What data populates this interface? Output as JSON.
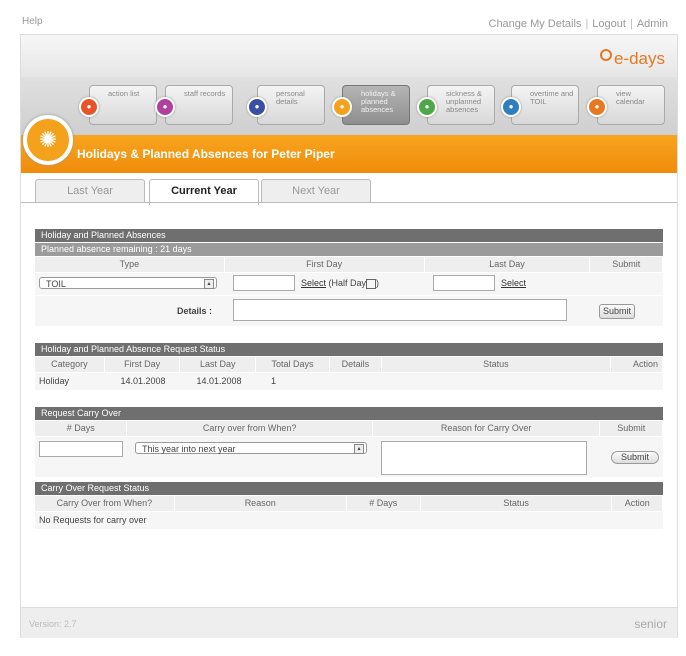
{
  "top": {
    "help": "Help",
    "change_details": "Change My Details",
    "logout": "Logout",
    "admin": "Admin",
    "sep": "|"
  },
  "logo": "e-days",
  "nav": [
    {
      "label": "action list",
      "color": "#e8542a"
    },
    {
      "label": "staff records",
      "color": "#b03fa0"
    },
    {
      "label": "personal details",
      "color": "#3a4fa3"
    },
    {
      "label": "holidays & planned absences",
      "color": "#f4a11c"
    },
    {
      "label": "sickness & unplanned absences",
      "color": "#4ea84a"
    },
    {
      "label": "overtime and TOIL",
      "color": "#2f7ec2"
    },
    {
      "label": "view calendar",
      "color": "#e87722"
    }
  ],
  "banner_title": "Holidays & Planned Absences for Peter Piper",
  "tabs": [
    "Last Year",
    "Current Year",
    "Next Year"
  ],
  "holiday": {
    "heading": "Holiday and Planned Absences",
    "remaining": "Planned absence remaining : 21 days",
    "cols": {
      "type": "Type",
      "first": "First Day",
      "last": "Last Day",
      "submit": "Submit"
    },
    "type_value": "TOIL",
    "select_label": "Select",
    "half_day": "(Half Day",
    "half_day_close": ")",
    "details_label": "Details :",
    "submit_label": "Submit"
  },
  "status": {
    "heading": "Holiday and Planned Absence Request Status",
    "cols": [
      "Category",
      "First Day",
      "Last Day",
      "Total Days",
      "Details",
      "Status",
      "Action"
    ],
    "rows": [
      {
        "category": "Holiday",
        "first": "14.01.2008",
        "last": "14.01.2008",
        "total": "1"
      }
    ]
  },
  "carry": {
    "heading": "Request Carry Over",
    "cols": {
      "days": "# Days",
      "from": "Carry over from When?",
      "reason": "Reason for Carry Over",
      "submit": "Submit"
    },
    "from_value": "This year into next year",
    "submit_label": "Submit"
  },
  "carry_status": {
    "heading": "Carry Over Request Status",
    "cols": [
      "Carry Over from When?",
      "Reason",
      "# Days",
      "Status",
      "Action"
    ],
    "empty": "No Requests for carry over"
  },
  "footer": {
    "version": "Version: 2.7",
    "brand": "senior"
  }
}
